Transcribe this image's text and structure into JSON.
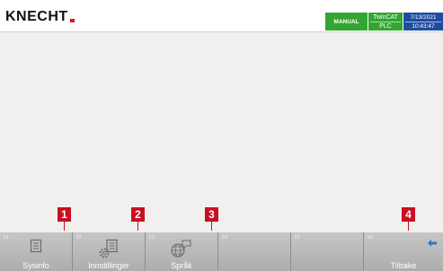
{
  "header": {
    "logo": "KNECHT",
    "mode": "MANUAL",
    "twincat_line1": "TwinCAT",
    "twincat_line2": "PLC",
    "date": "7/13/2021",
    "time": "10:43:47"
  },
  "callouts": [
    "1",
    "2",
    "3",
    "4"
  ],
  "fkeys": [
    {
      "num": "F1",
      "label": "Sysinfo",
      "icon": "document-list-icon"
    },
    {
      "num": "F2",
      "label": "Innstillinger",
      "icon": "settings-document-icon"
    },
    {
      "num": "F3",
      "label": "Språk",
      "icon": "language-globe-icon"
    },
    {
      "num": "F4",
      "label": "",
      "icon": ""
    },
    {
      "num": "F5",
      "label": "",
      "icon": ""
    },
    {
      "num": "F6",
      "label": "Tilbake",
      "icon": "back-arrow-icon"
    }
  ],
  "colors": {
    "mode_bg": "#33a532",
    "date_bg": "#1e4da0",
    "callout_bg": "#c71020"
  }
}
